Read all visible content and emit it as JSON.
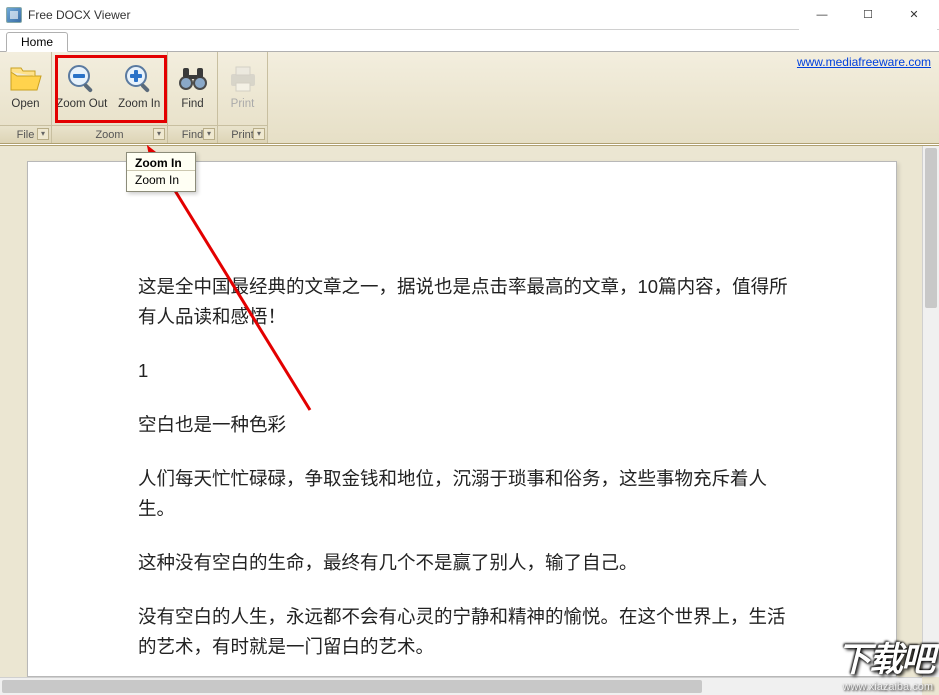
{
  "window": {
    "title": "Free DOCX Viewer",
    "min_glyph": "—",
    "max_glyph": "☐",
    "close_glyph": "✕"
  },
  "tabs": {
    "home": "Home"
  },
  "ribbon": {
    "open": "Open",
    "zoom_out": "Zoom Out",
    "zoom_in": "Zoom In",
    "find": "Find",
    "print": "Print",
    "group_file": "File",
    "group_zoom": "Zoom",
    "group_find": "Find",
    "group_print": "Print",
    "launcher_glyph": "▾"
  },
  "link": {
    "text": "www.mediafreeware.com"
  },
  "tooltip": {
    "title": "Zoom In",
    "body": "Zoom In"
  },
  "document": {
    "p1": "这是全中国最经典的文章之一，据说也是点击率最高的文章，10篇内容，值得所有人品读和感悟！",
    "p2": "1",
    "p3": "空白也是一种色彩",
    "p4": "人们每天忙忙碌碌，争取金钱和地位，沉溺于琐事和俗务，这些事物充斥着人生。",
    "p5": "这种没有空白的生命，最终有几个不是赢了别人，输了自己。",
    "p6": "没有空白的人生，永远都不会有心灵的宁静和精神的愉悦。在这个世界上，生活的艺术，有时就是一门留白的艺术。"
  },
  "watermark": {
    "big": "下载吧",
    "small": "www.xiazaiba.com"
  }
}
